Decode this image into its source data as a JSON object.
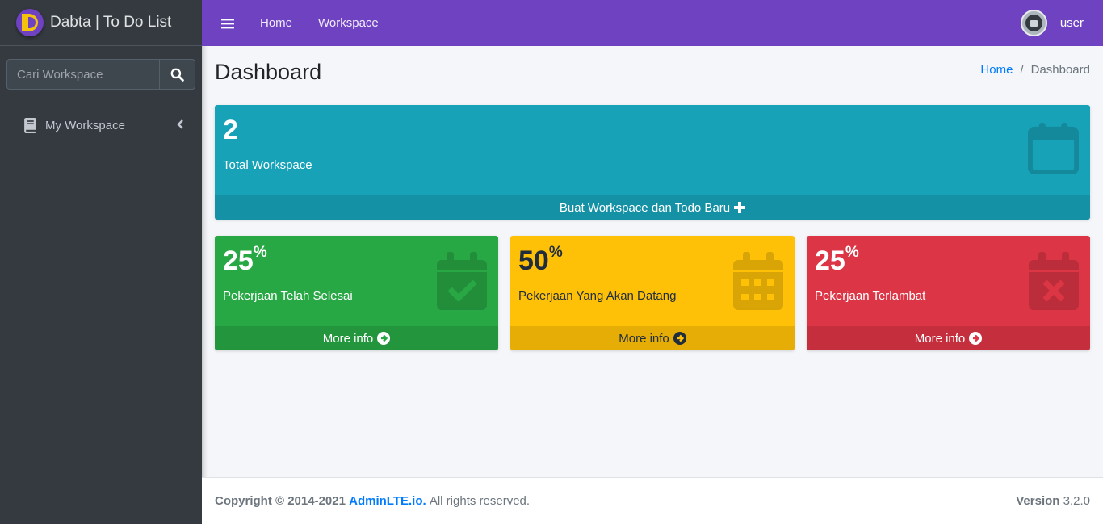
{
  "brand": {
    "title": "Dabta | To Do List"
  },
  "sidebar": {
    "search_placeholder": "Cari Workspace",
    "items": [
      {
        "label": "My Workspace",
        "icon": "book-icon"
      }
    ]
  },
  "navbar": {
    "links": [
      "Home",
      "Workspace"
    ],
    "user": "user"
  },
  "page": {
    "title": "Dashboard",
    "breadcrumb": [
      "Home",
      "Dashboard"
    ]
  },
  "cards": {
    "total": {
      "value": "2",
      "label": "Total Workspace",
      "footer": "Buat Workspace dan Todo Baru",
      "color": "#17a2b8"
    },
    "done": {
      "value": "25",
      "unit": "%",
      "label": "Pekerjaan Telah Selesai",
      "footer": "More info",
      "color": "#28a745"
    },
    "upcoming": {
      "value": "50",
      "unit": "%",
      "label": "Pekerjaan Yang Akan Datang",
      "footer": "More info",
      "color": "#ffc107"
    },
    "late": {
      "value": "25",
      "unit": "%",
      "label": "Pekerjaan Terlambat",
      "footer": "More info",
      "color": "#dc3545"
    }
  },
  "footer": {
    "copyright": "Copyright © 2014-2021",
    "link": "AdminLTE.io.",
    "rights": "All rights reserved.",
    "version_label": "Version",
    "version": "3.2.0"
  },
  "colors": {
    "navbar": "#6f42c1",
    "sidebar": "#343a40",
    "link": "#007bff"
  }
}
